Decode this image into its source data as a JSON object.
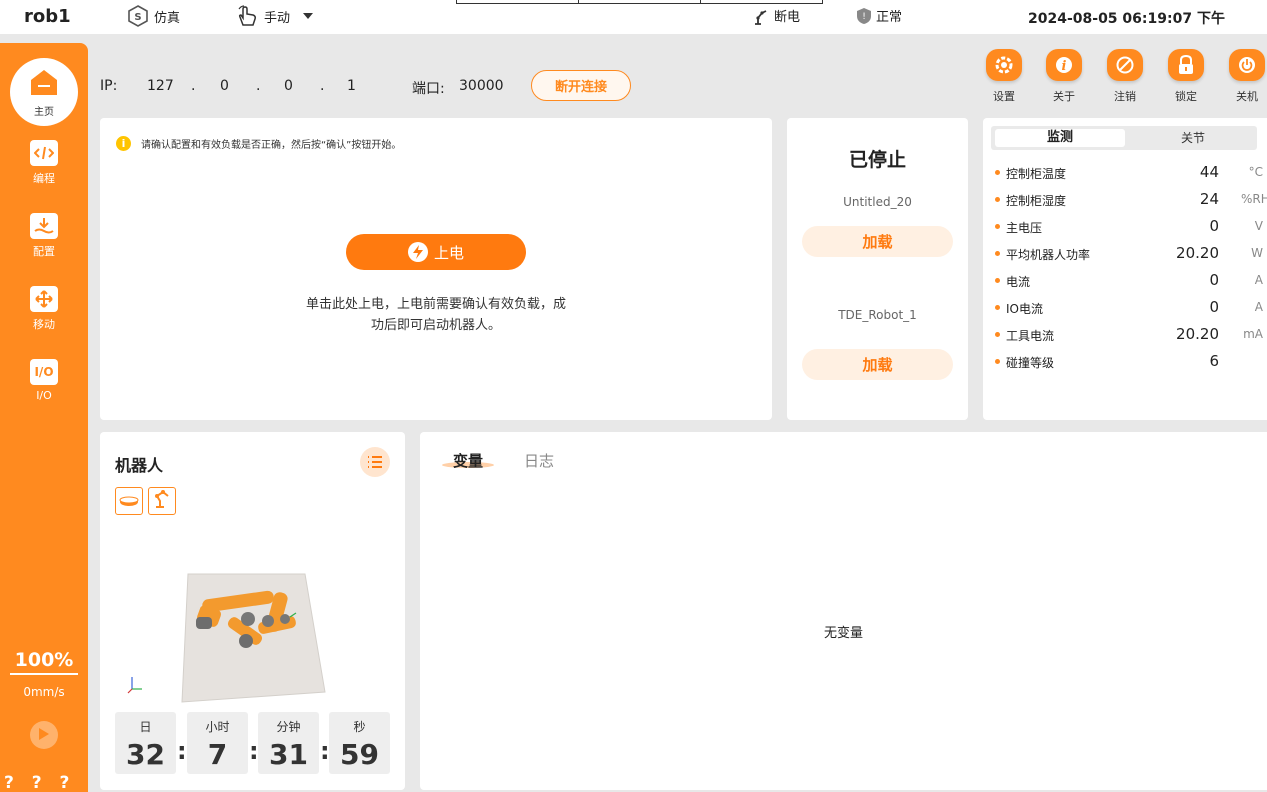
{
  "topbar": {
    "robot_name": "rob1",
    "sim_label": "仿真",
    "sim_icon": "s-sim-icon",
    "manual_label": "手动",
    "power_status": "断电",
    "safety_status": "正常",
    "datetime": "2024-08-05 06:19:07 下午"
  },
  "sidebar": {
    "items": [
      {
        "label": "主页",
        "icon": "home-icon"
      },
      {
        "label": "编程",
        "icon": "code-icon"
      },
      {
        "label": "配置",
        "icon": "config-download-icon"
      },
      {
        "label": "移动",
        "icon": "move-arrows-icon"
      },
      {
        "label": "I/O",
        "icon": "io-icon",
        "tile_text": "I/O"
      }
    ],
    "speed_percent": "100%",
    "speed_mm": "0mm/s",
    "bottom_glyphs": "? ? ? ?"
  },
  "connection": {
    "ip_label": "IP:",
    "ip": [
      "127",
      ".",
      "0",
      ".",
      "0",
      ".",
      "1"
    ],
    "port_label": "端口:",
    "port": "30000",
    "disconnect_label": "断开连接"
  },
  "actions": [
    {
      "label": "设置",
      "icon": "settings-icon"
    },
    {
      "label": "关于",
      "icon": "info-icon"
    },
    {
      "label": "注销",
      "icon": "logout-icon"
    },
    {
      "label": "锁定",
      "icon": "lock-icon"
    },
    {
      "label": "关机",
      "icon": "power-icon"
    }
  ],
  "power_card": {
    "notice": "请确认配置和有效负载是否正确，然后按“确认”按钮开始。",
    "power_button": "上电",
    "hint_line1": "单击此处上电，上电前需要确认有效负载，成",
    "hint_line2": "功后即可启动机器人。"
  },
  "program_card": {
    "status": "已停止",
    "program_name": "Untitled_20",
    "load_label_1": "加载",
    "robot_model": "TDE_Robot_1",
    "load_label_2": "加载"
  },
  "monitor": {
    "tab_active": "监测",
    "tab_other": "关节",
    "rows": [
      {
        "label": "控制柜温度",
        "value": "44",
        "unit": "°C"
      },
      {
        "label": "控制柜湿度",
        "value": "24",
        "unit": "%RH"
      },
      {
        "label": "主电压",
        "value": "0",
        "unit": "V"
      },
      {
        "label": "平均机器人功率",
        "value": "20.20",
        "unit": "W"
      },
      {
        "label": "电流",
        "value": "0",
        "unit": "A"
      },
      {
        "label": "IO电流",
        "value": "0",
        "unit": "A"
      },
      {
        "label": "工具电流",
        "value": "20.20",
        "unit": "mA"
      },
      {
        "label": "碰撞等级",
        "value": "6",
        "unit": ""
      }
    ]
  },
  "robot_card": {
    "title": "机器人",
    "timer": [
      {
        "unit": "日",
        "value": "32"
      },
      {
        "unit": "小时",
        "value": "7"
      },
      {
        "unit": "分钟",
        "value": "31"
      },
      {
        "unit": "秒",
        "value": "59"
      }
    ],
    "separator": ":"
  },
  "var_card": {
    "tab_variables": "变量",
    "tab_log": "日志",
    "empty_text": "无变量"
  },
  "colors": {
    "accent": "#ff8a1f",
    "accent_light": "#fff0e2",
    "background": "#e8e8e8"
  }
}
